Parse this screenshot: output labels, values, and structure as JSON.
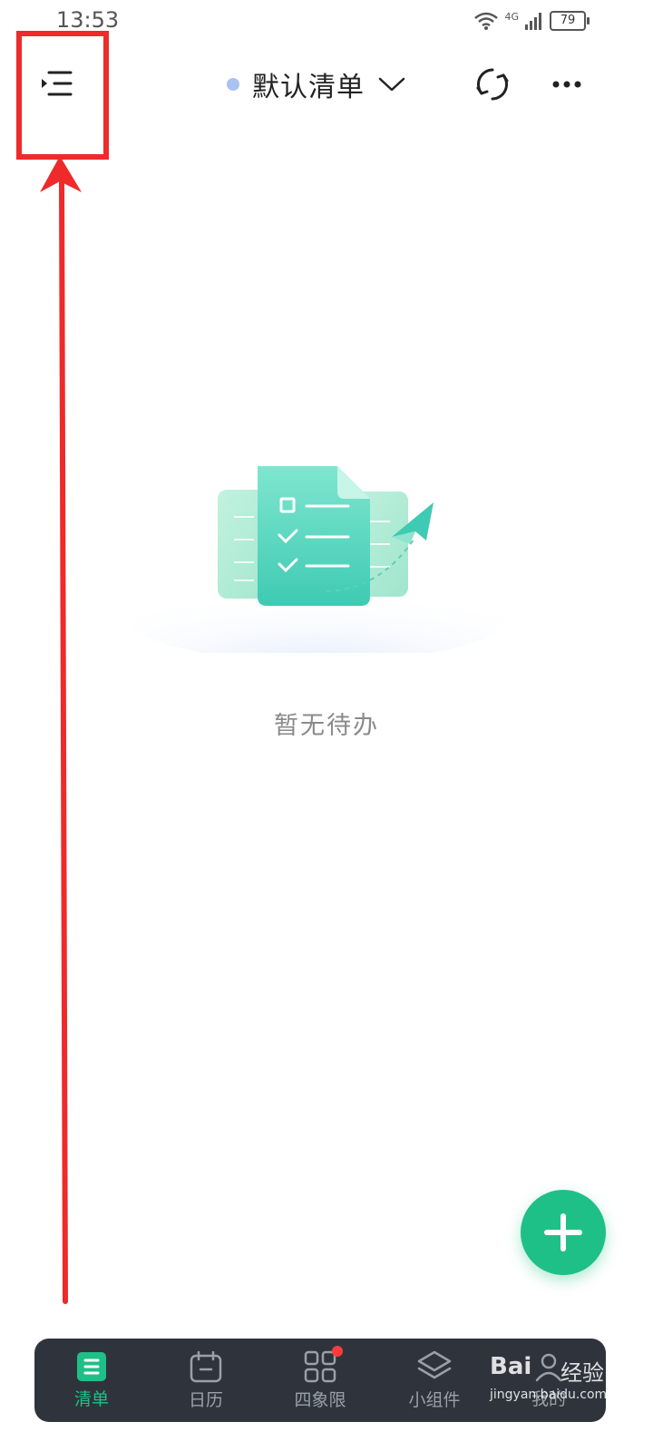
{
  "status_bar": {
    "time": "13:53",
    "network": "4G",
    "battery": "79"
  },
  "header": {
    "menu_icon": "menu-collapse-icon",
    "title": "默认清单",
    "title_dot_color": "#a9c2f0",
    "sync_icon": "sync-icon",
    "more_icon": "more-icon"
  },
  "empty_state": {
    "illustration": "todo-list-illustration",
    "text": "暂无待办"
  },
  "fab": {
    "icon": "plus-icon",
    "color": "#1fbf88"
  },
  "bottom_nav": {
    "items": [
      {
        "label": "清单",
        "icon": "list-icon",
        "active": true
      },
      {
        "label": "日历",
        "icon": "calendar-icon",
        "active": false
      },
      {
        "label": "四象限",
        "icon": "quadrant-icon",
        "active": false,
        "badge": true
      },
      {
        "label": "小组件",
        "icon": "widget-icon",
        "active": false
      },
      {
        "label": "我的",
        "icon": "profile-icon",
        "active": false
      }
    ]
  },
  "watermark": {
    "brand": "Bai",
    "brand_suffix": "经验",
    "url": "jingyan.baidu.com"
  },
  "annotation": {
    "color": "#ee2a2a"
  }
}
